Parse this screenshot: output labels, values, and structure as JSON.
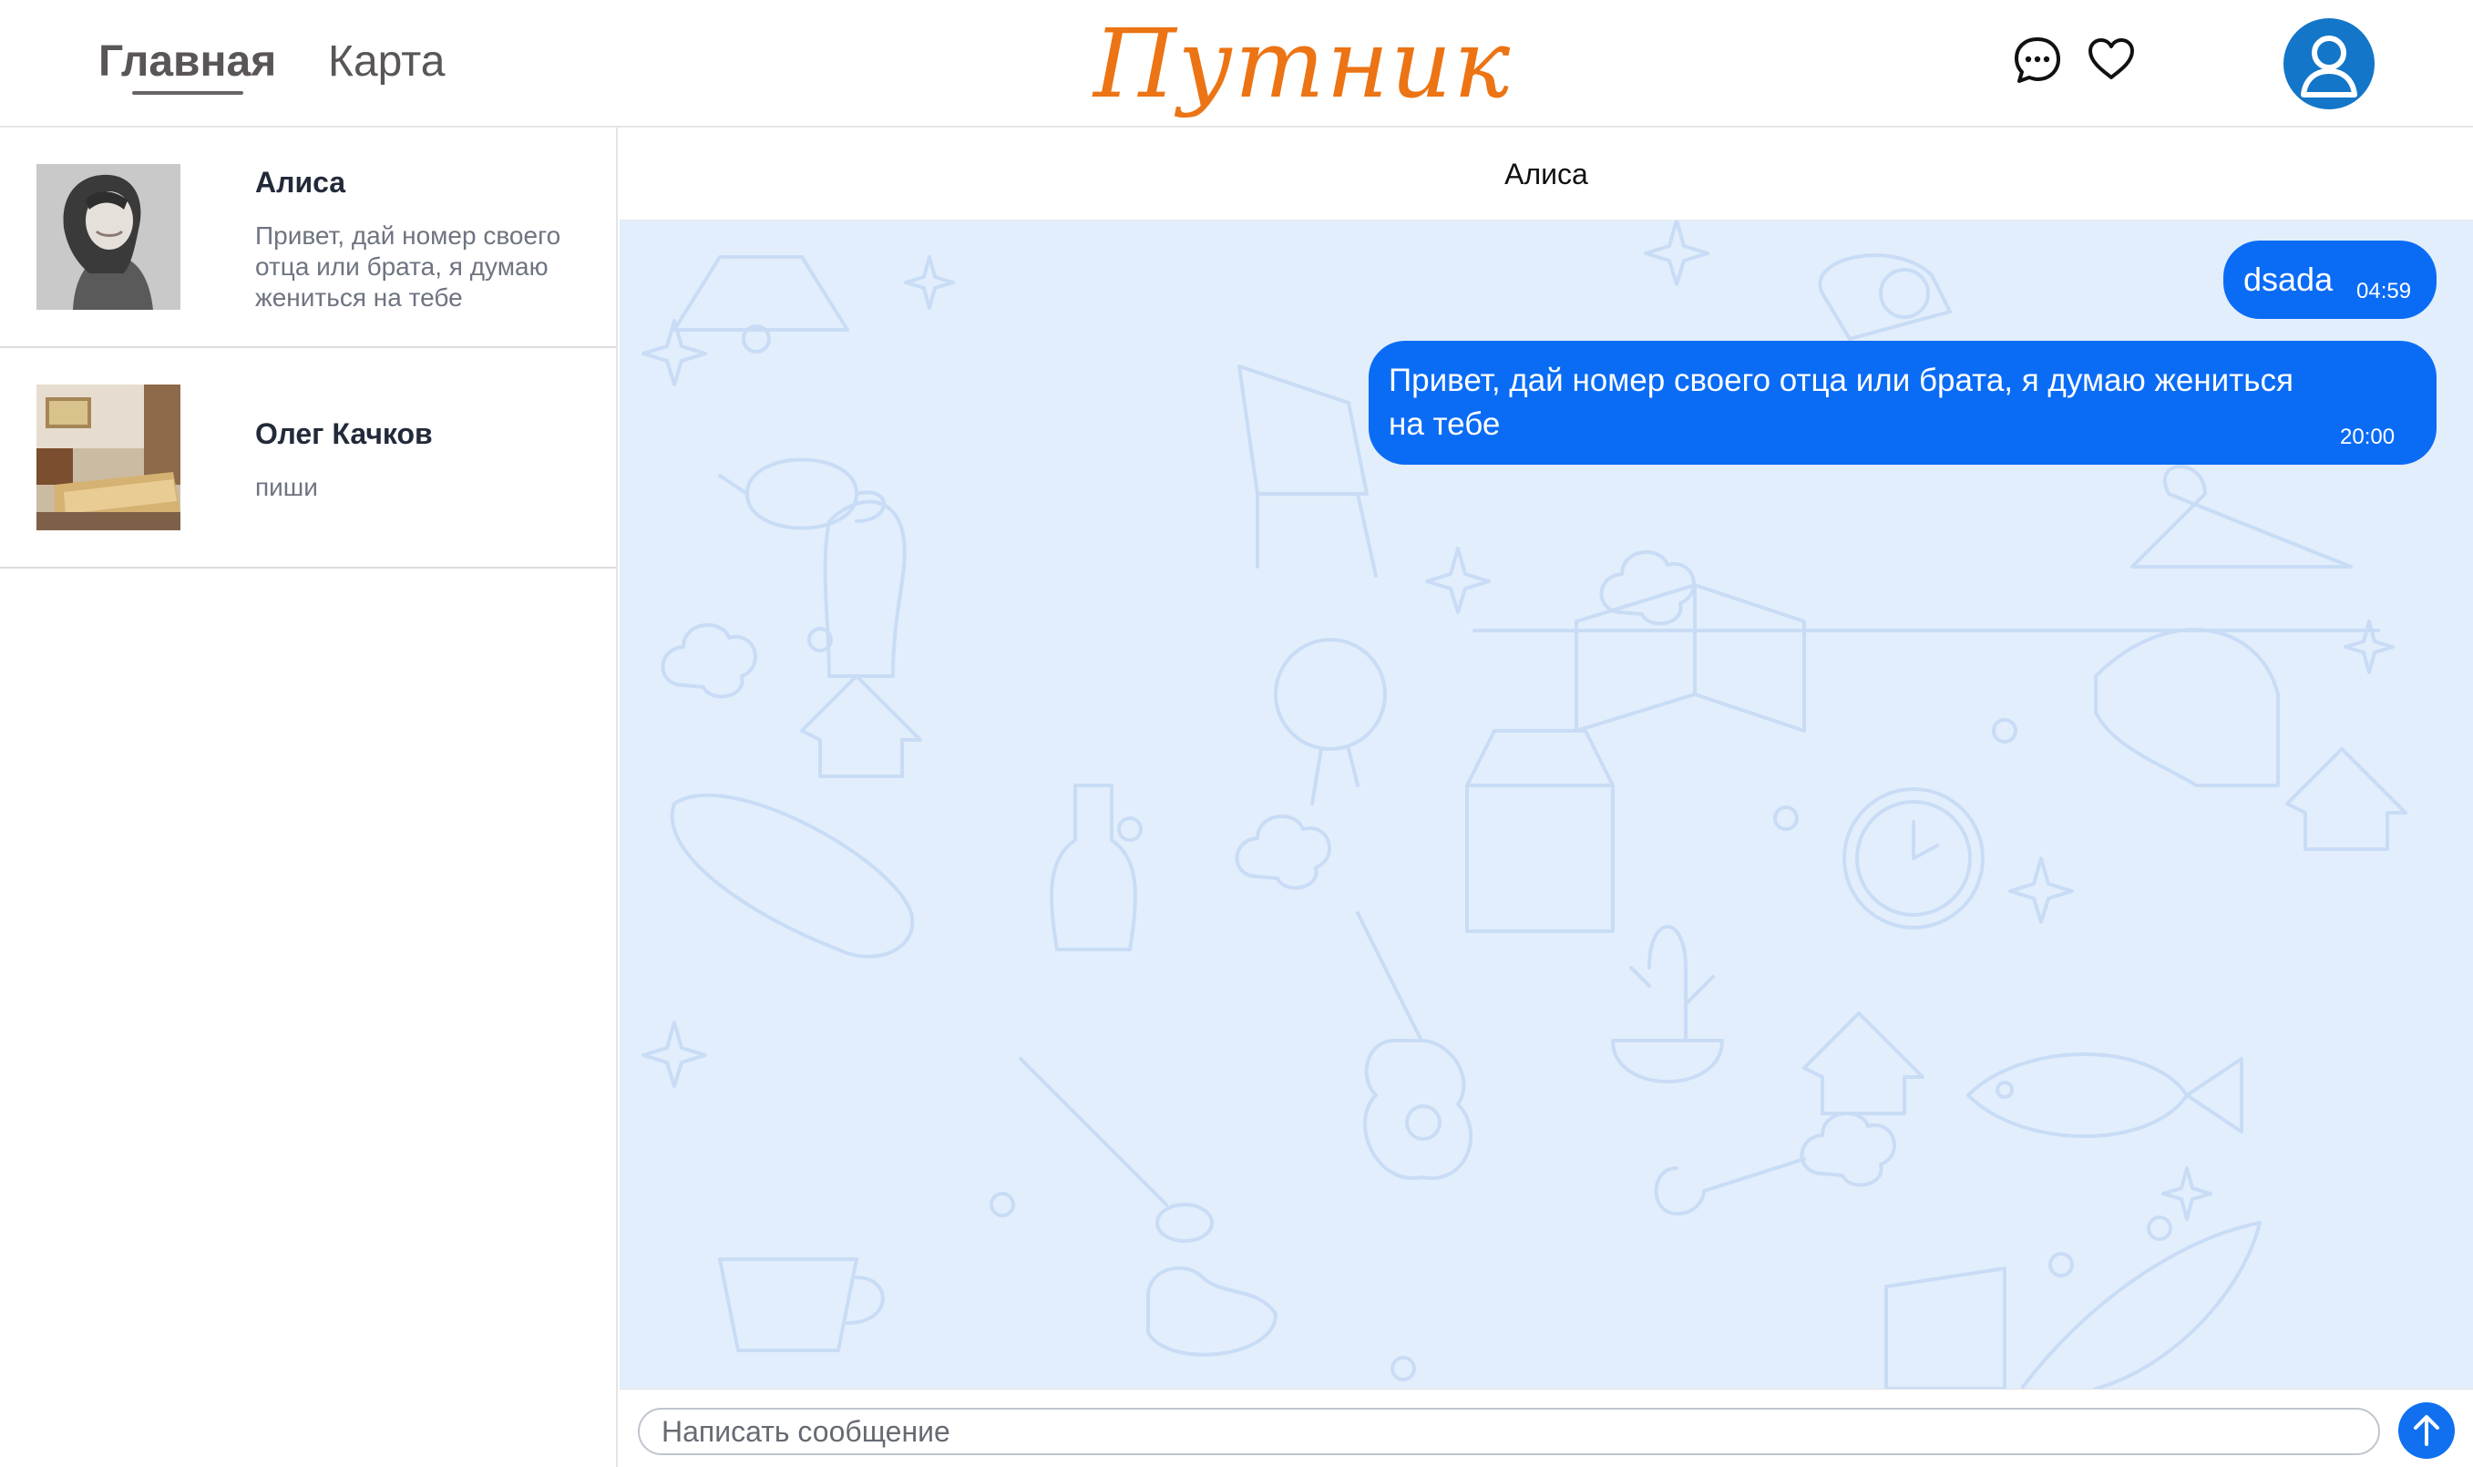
{
  "nav": {
    "home_label": "Главная",
    "map_label": "Карта"
  },
  "brand": {
    "logo_text": "Путник",
    "accent_color": "#ec7414"
  },
  "header_icons": [
    "chat-icon",
    "heart-icon",
    "user-avatar-icon"
  ],
  "conversations": [
    {
      "name": "Алиса",
      "preview": "Привет, дай номер своего отца или брата, я думаю жениться на тебе",
      "thumb": "woman-portrait"
    },
    {
      "name": "Олег Качков",
      "preview": "пиши",
      "thumb": "hotel-room"
    }
  ],
  "chat": {
    "title": "Алиса",
    "messages": [
      {
        "text": "dsada",
        "time": "04:59"
      },
      {
        "text": "Привет, дай номер своего отца или брата, я думаю жениться на тебе",
        "time": "20:00"
      }
    ],
    "bubble_color": "#0a6cf5",
    "background_color": "#e2eefc"
  },
  "composer": {
    "placeholder": "Написать сообщение",
    "send_icon": "arrow-up-icon"
  }
}
